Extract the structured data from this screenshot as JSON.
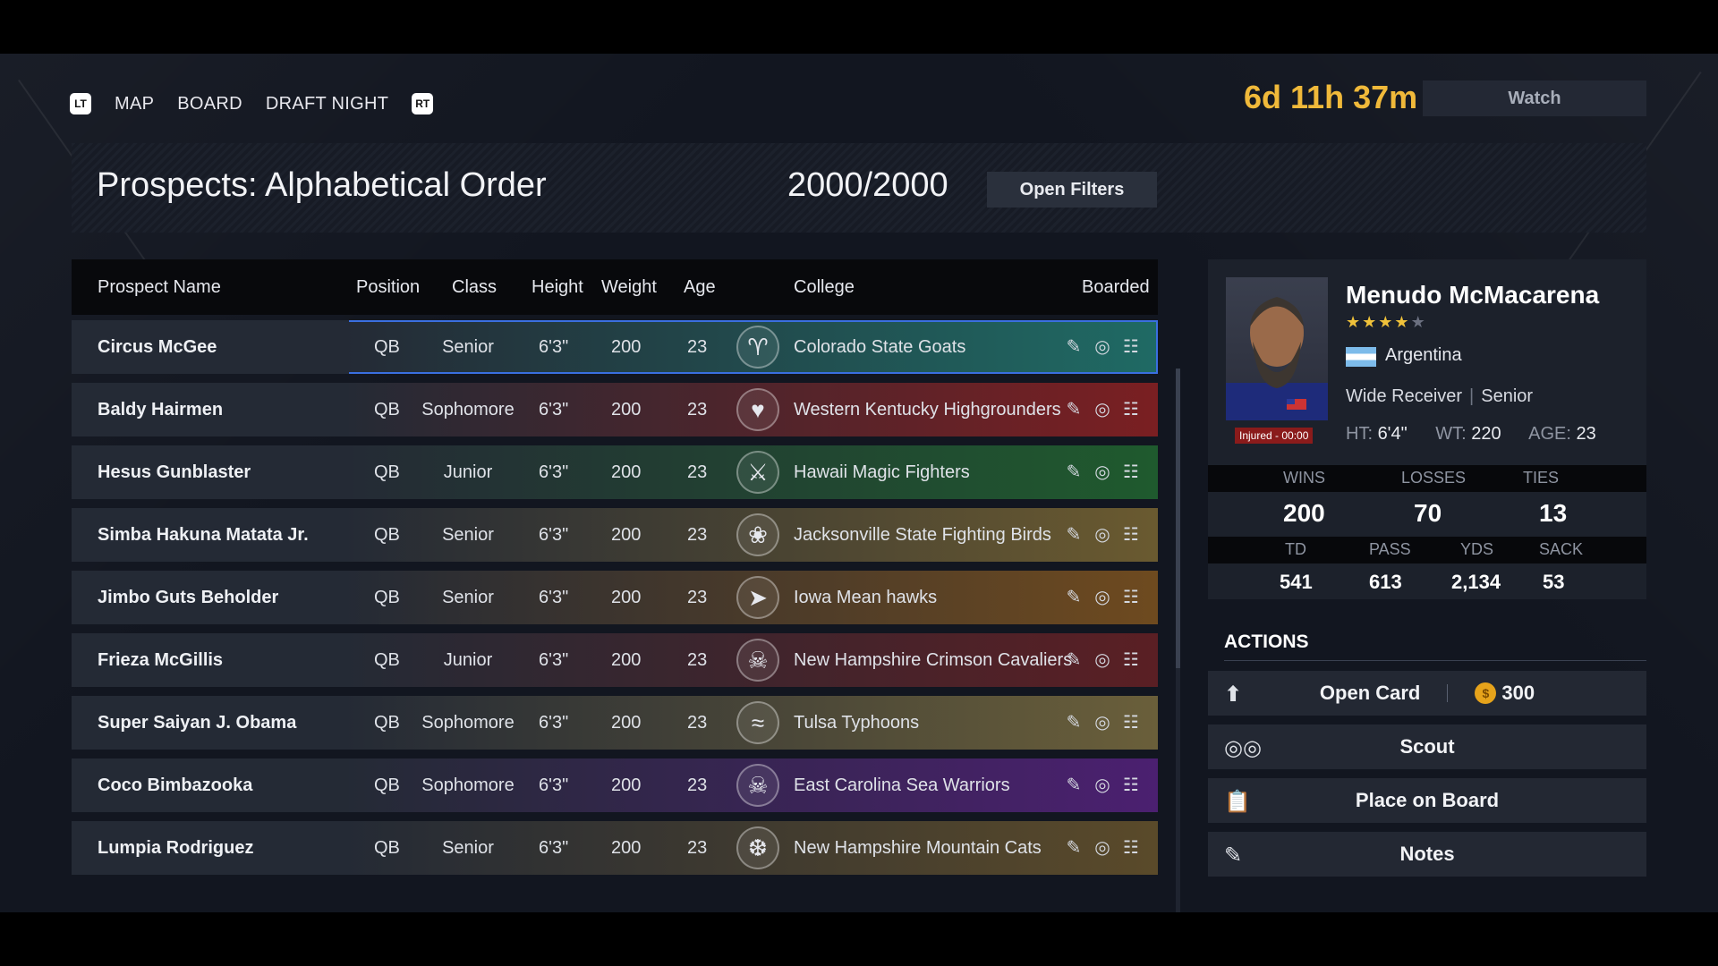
{
  "nav": {
    "left_button": "LT",
    "right_button": "RT",
    "items": [
      "MAP",
      "BOARD",
      "DRAFT NIGHT"
    ],
    "timer": "6d 11h 37m",
    "watch_label": "Watch"
  },
  "header": {
    "title": "Prospects: Alphabetical Order",
    "count": "2000/2000",
    "filters_label": "Open Filters"
  },
  "table": {
    "columns": {
      "name": "Prospect Name",
      "position": "Position",
      "class": "Class",
      "height": "Height",
      "weight": "Weight",
      "age": "Age",
      "college": "College",
      "boarded": "Boarded"
    },
    "rows": [
      {
        "name": "Circus McGee",
        "position": "QB",
        "class": "Senior",
        "height": "6'3\"",
        "weight": "200",
        "age": "23",
        "college": "Colorado State Goats",
        "color": "#1f6a64",
        "logo_icon": "goat-icon"
      },
      {
        "name": "Baldy Hairmen",
        "position": "QB",
        "class": "Sophomore",
        "height": "6'3\"",
        "weight": "200",
        "age": "23",
        "college": "Western Kentucky Highgrounders",
        "color": "#7a1f22",
        "logo_icon": "red-mascot-icon"
      },
      {
        "name": "Hesus Gunblaster",
        "position": "QB",
        "class": "Junior",
        "height": "6'3\"",
        "weight": "200",
        "age": "23",
        "college": "Hawaii Magic Fighters",
        "color": "#1f5a2e",
        "logo_icon": "fighter-icon"
      },
      {
        "name": "Simba Hakuna Matata Jr.",
        "position": "QB",
        "class": "Senior",
        "height": "6'3\"",
        "weight": "200",
        "age": "23",
        "college": "Jacksonville State Fighting Birds",
        "color": "#6a5a30",
        "logo_icon": "bird-icon"
      },
      {
        "name": "Jimbo Guts Beholder",
        "position": "QB",
        "class": "Senior",
        "height": "6'3\"",
        "weight": "200",
        "age": "23",
        "college": "Iowa Mean hawks",
        "color": "#6e4a1f",
        "logo_icon": "hawk-icon"
      },
      {
        "name": "Frieza McGillis",
        "position": "QB",
        "class": "Junior",
        "height": "6'3\"",
        "weight": "200",
        "age": "23",
        "college": "New Hampshire Crimson Cavaliers",
        "color": "#5a1f24",
        "logo_icon": "cavalier-icon"
      },
      {
        "name": "Super Saiyan J. Obama",
        "position": "QB",
        "class": "Sophomore",
        "height": "6'3\"",
        "weight": "200",
        "age": "23",
        "college": "Tulsa Typhoons",
        "color": "#6a5f3a",
        "logo_icon": "typhoon-icon"
      },
      {
        "name": "Coco Bimbazooka",
        "position": "QB",
        "class": "Sophomore",
        "height": "6'3\"",
        "weight": "200",
        "age": "23",
        "college": "East Carolina Sea Warriors",
        "color": "#4b2070",
        "logo_icon": "pirate-icon"
      },
      {
        "name": "Lumpia Rodriguez",
        "position": "QB",
        "class": "Senior",
        "height": "6'3\"",
        "weight": "200",
        "age": "23",
        "college": "New Hampshire Mountain Cats",
        "color": "#5a4a2a",
        "logo_icon": "wildcat-icon"
      }
    ]
  },
  "profile": {
    "name": "Menudo McMacarena",
    "stars_filled": 4,
    "stars_total": 5,
    "country": "Argentina",
    "position": "Wide Receiver",
    "class": "Senior",
    "status": "Injured - 00:00",
    "ht_label": "HT:",
    "ht": "6'4\"",
    "wt_label": "WT:",
    "wt": "220",
    "age_label": "AGE:",
    "age": "23",
    "record_labels": [
      "WINS",
      "LOSSES",
      "TIES"
    ],
    "record_values": [
      "200",
      "70",
      "13"
    ],
    "stat_labels": [
      "TD",
      "PASS",
      "YDS",
      "SACK"
    ],
    "stat_values": [
      "541",
      "613",
      "2,134",
      "53"
    ]
  },
  "actions": {
    "title": "ACTIONS",
    "open_card": "Open Card",
    "open_card_cost": "300",
    "scout": "Scout",
    "place_on_board": "Place on Board",
    "notes": "Notes"
  },
  "colors": {
    "accent": "#f0b93a",
    "selected_outline": "#3a6fe0"
  }
}
